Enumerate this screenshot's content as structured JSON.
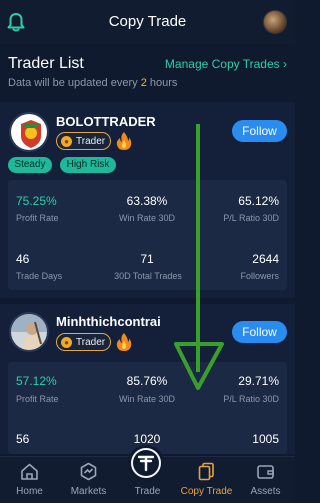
{
  "header": {
    "title": "Copy Trade",
    "bell_icon": "bell-icon",
    "avatar": "user-avatar"
  },
  "trader_list": {
    "heading": "Trader List",
    "manage_link": "Manage Copy Trades",
    "note_prefix": "Data will be updated every ",
    "note_hours": "2",
    "note_suffix": " hours"
  },
  "traders": [
    {
      "name": "BOLOTTRADER",
      "badge": "Trader",
      "follow": "Follow",
      "tags": [
        "Steady",
        "High Risk"
      ],
      "stats": {
        "profit_rate": "75.25%",
        "profit_rate_label": "Profit Rate",
        "win_rate": "63.38%",
        "win_rate_label": "Win Rate 30D",
        "pl_ratio": "65.12%",
        "pl_ratio_label": "P/L Ratio 30D",
        "trade_days": "46",
        "trade_days_label": "Trade Days",
        "total_trades": "71",
        "total_trades_label": "30D Total Trades",
        "followers": "2644",
        "followers_label": "Followers"
      }
    },
    {
      "name": "Minhthichcontrai",
      "badge": "Trader",
      "follow": "Follow",
      "stats": {
        "profit_rate": "57.12%",
        "profit_rate_label": "Profit Rate",
        "win_rate": "85.76%",
        "win_rate_label": "Win Rate 30D",
        "pl_ratio": "29.71%",
        "pl_ratio_label": "P/L Ratio 30D",
        "trade_days": "56",
        "total_trades": "1020",
        "followers": "1005"
      }
    }
  ],
  "nav": {
    "items": [
      {
        "label": "Home",
        "icon": "home-icon"
      },
      {
        "label": "Markets",
        "icon": "markets-icon"
      },
      {
        "label": "Trade",
        "icon": "trade-icon"
      },
      {
        "label": "Copy Trade",
        "icon": "copy-trade-icon"
      },
      {
        "label": "Assets",
        "icon": "wallet-icon"
      }
    ],
    "active": "Copy Trade"
  },
  "colors": {
    "background": "#0f1a2e",
    "card": "#142039",
    "accent_green": "#2ecfa7",
    "follow_blue": "#2b8cf0",
    "active_orange": "#e8a33a",
    "arrow_green": "#3aa02c"
  }
}
